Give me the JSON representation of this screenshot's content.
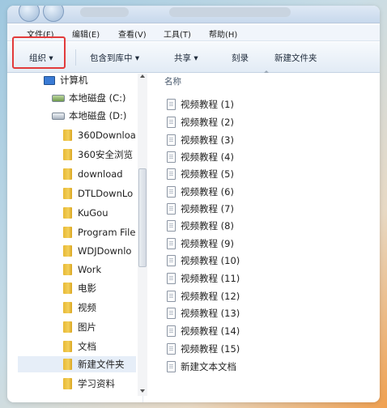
{
  "menubar": [
    "文件(F)",
    "编辑(E)",
    "查看(V)",
    "工具(T)",
    "帮助(H)"
  ],
  "toolbar": {
    "organize": "组织 ▾",
    "include_in_library": "包含到库中 ▾",
    "share": "共享 ▾",
    "burn": "刻录",
    "new_folder": "新建文件夹"
  },
  "nav": {
    "computer": "计算机",
    "disk_c": "本地磁盘 (C:)",
    "disk_d": "本地磁盘 (D:)",
    "folders": [
      "360Downloa",
      "360安全浏览",
      "download",
      "DTLDownLo",
      "KuGou",
      "Program File",
      "WDJDownlo",
      "Work",
      "电影",
      "视频",
      "图片",
      "文档",
      "新建文件夹",
      "学习资料"
    ],
    "selected_folder": "新建文件夹"
  },
  "files": {
    "column_name": "名称",
    "items": [
      "视频教程 (1)",
      "视频教程 (2)",
      "视频教程 (3)",
      "视频教程 (4)",
      "视频教程 (5)",
      "视频教程 (6)",
      "视频教程 (7)",
      "视频教程 (8)",
      "视频教程 (9)",
      "视频教程 (10)",
      "视频教程 (11)",
      "视频教程 (12)",
      "视频教程 (13)",
      "视频教程 (14)",
      "视频教程 (15)",
      "新建文本文档"
    ]
  },
  "colors": {
    "highlight_box": "#e23b3b",
    "selection": "#e6eef8"
  }
}
